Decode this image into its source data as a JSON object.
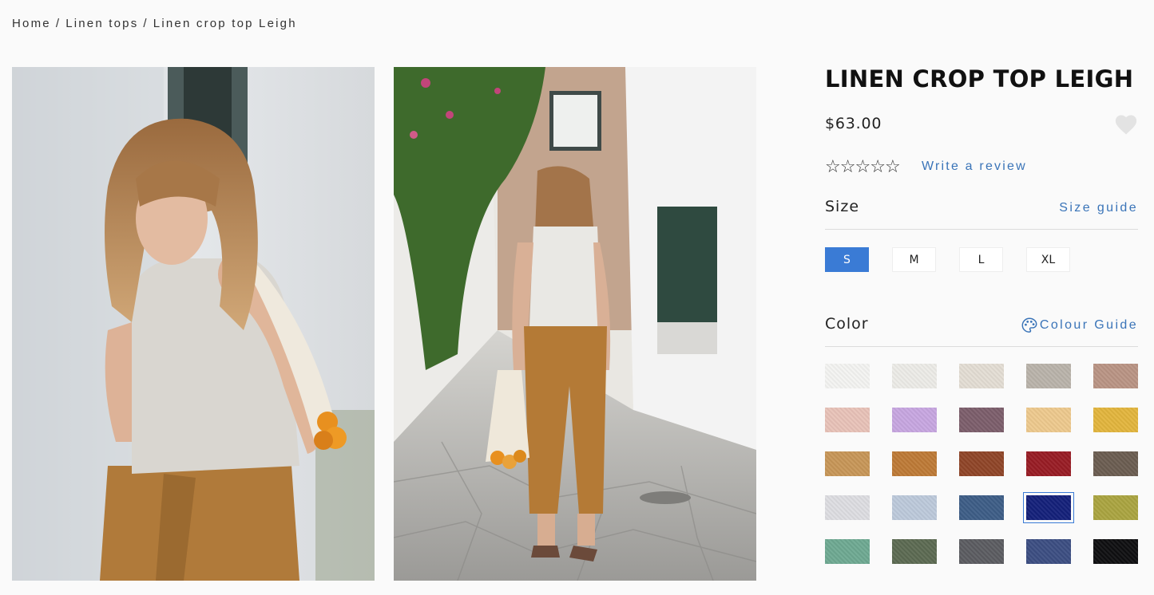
{
  "breadcrumb": {
    "items": [
      "Home",
      "Linen tops",
      "Linen crop top Leigh"
    ],
    "separator": "/"
  },
  "product": {
    "title": "LINEN CROP TOP LEIGH",
    "price": "$63.00",
    "rating_stars": 5,
    "rating_filled": 0,
    "write_review": "Write a review",
    "wishlist_icon": "heart-icon"
  },
  "size": {
    "label": "Size",
    "guide_link": "Size guide",
    "options": [
      "S",
      "M",
      "L",
      "XL"
    ],
    "selected": "S"
  },
  "color": {
    "label": "Color",
    "guide_link": "Colour Guide",
    "guide_icon": "palette-icon",
    "selected_index": 18,
    "swatches": [
      "#f3f3f1",
      "#ecebe7",
      "#e3ddd3",
      "#b9b3aa",
      "#b99484",
      "#e8c2b8",
      "#c7a6e0",
      "#7c5e6b",
      "#edc98d",
      "#e2b53d",
      "#c79657",
      "#bd7a36",
      "#8f4528",
      "#981c24",
      "#6b5d51",
      "#dddde1",
      "#bcc9da",
      "#3d5d86",
      "#14207a",
      "#aaa440",
      "#6ea992",
      "#5c6a52",
      "#5b5c61",
      "#3c4e82",
      "#0f0f11"
    ]
  },
  "images": [
    {
      "icon": "product-photo-front"
    },
    {
      "icon": "product-photo-back"
    }
  ],
  "colors": {
    "accent": "#3a7bd5",
    "link": "#3a74b8"
  }
}
